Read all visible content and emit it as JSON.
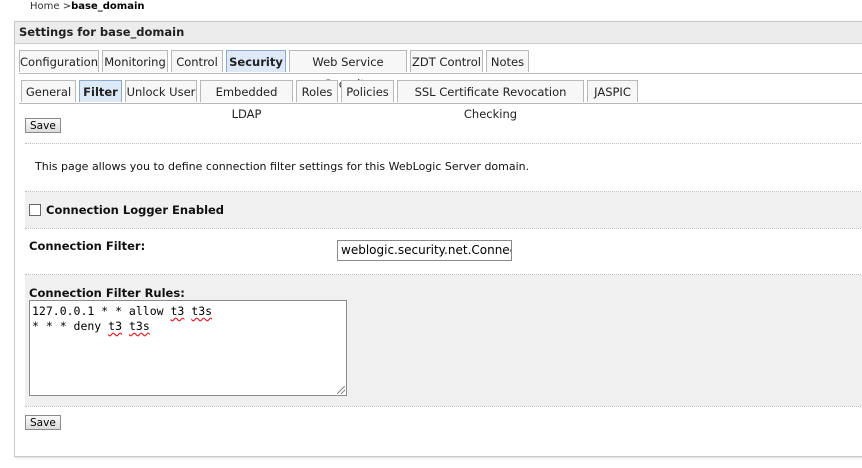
{
  "breadcrumb": {
    "home": "Home",
    "separator": ">",
    "current": "base_domain"
  },
  "panel": {
    "title": "Settings for base_domain"
  },
  "tabs": [
    {
      "label": "Configuration",
      "active": false
    },
    {
      "label": "Monitoring",
      "active": false
    },
    {
      "label": "Control",
      "active": false
    },
    {
      "label": "Security",
      "active": true
    },
    {
      "label": "Web Service Security",
      "active": false
    },
    {
      "label": "ZDT Control",
      "active": false
    },
    {
      "label": "Notes",
      "active": false
    }
  ],
  "subtabs": [
    {
      "label": "General",
      "active": false
    },
    {
      "label": "Filter",
      "active": true
    },
    {
      "label": "Unlock User",
      "active": false
    },
    {
      "label": "Embedded LDAP",
      "active": false
    },
    {
      "label": "Roles",
      "active": false
    },
    {
      "label": "Policies",
      "active": false
    },
    {
      "label": "SSL Certificate Revocation Checking",
      "active": false
    },
    {
      "label": "JASPIC",
      "active": false
    }
  ],
  "save_label": "Save",
  "description": "This page allows you to define connection filter settings for this WebLogic Server domain.",
  "connection_logger": {
    "label": "Connection Logger Enabled",
    "checked": false
  },
  "connection_filter": {
    "label": "Connection Filter:",
    "value": "weblogic.security.net.ConnectionFilterImpl"
  },
  "filter_rules": {
    "label": "Connection Filter Rules:",
    "line1_prefix": "127.0.0.1 * * allow ",
    "line1_t3": "t3",
    "line1_t3s": "t3s",
    "line2_prefix": "* * * deny ",
    "line2_t3": "t3",
    "line2_t3s": "t3s"
  }
}
